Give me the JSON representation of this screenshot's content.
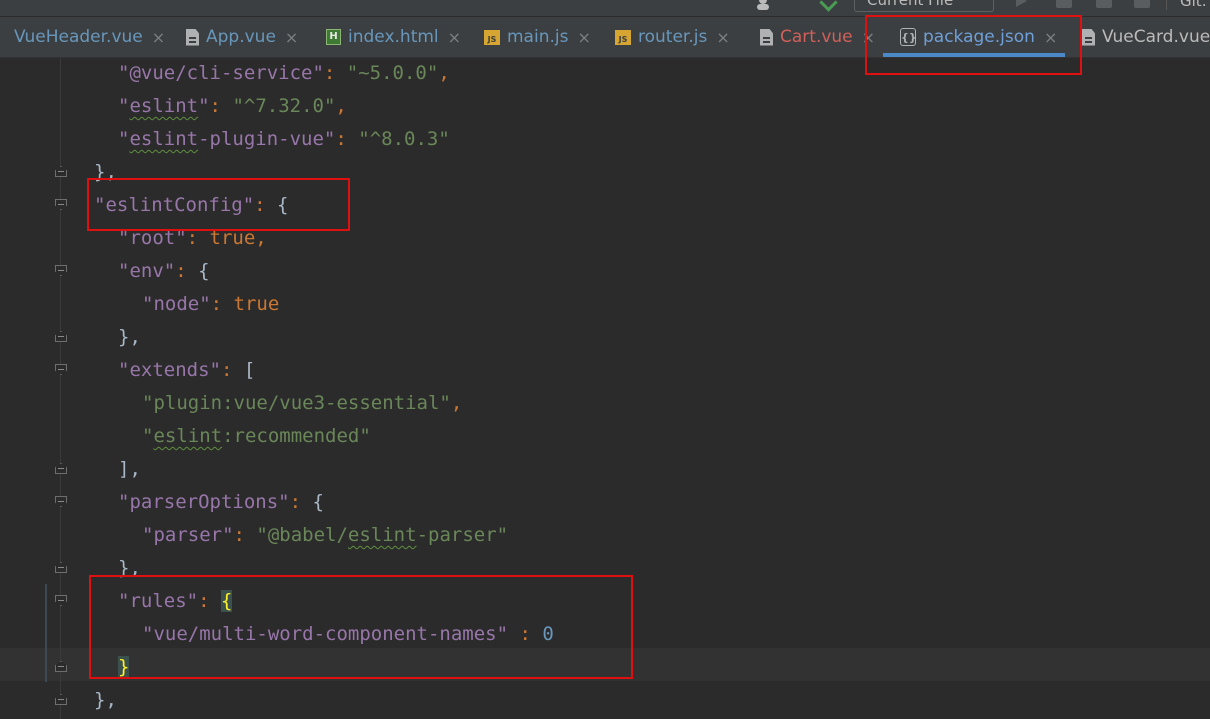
{
  "toolbar": {
    "run_config": "Current File",
    "git_label": "Git:"
  },
  "tabs": [
    {
      "label": "VueHeader.vue",
      "icon": "vue-file-icon",
      "color": "blue",
      "close": "×"
    },
    {
      "label": "App.vue",
      "icon": "vue-file-icon",
      "color": "blue",
      "close": "×"
    },
    {
      "label": "index.html",
      "icon": "html-file-icon",
      "color": "blue",
      "close": "×"
    },
    {
      "label": "main.js",
      "icon": "js-file-icon",
      "color": "blue",
      "close": "×"
    },
    {
      "label": "router.js",
      "icon": "js-file-icon",
      "color": "blue",
      "close": "×"
    },
    {
      "label": "Cart.vue",
      "icon": "vue-file-icon",
      "color": "red",
      "close": "×"
    },
    {
      "label": "package.json",
      "icon": "json-file-icon",
      "color": "active",
      "close": "×"
    },
    {
      "label": "VueCard.vue",
      "icon": "vue-file-icon",
      "color": "white",
      "close": ""
    }
  ],
  "code": {
    "l1": {
      "key": "\"@vue/cli-service\"",
      "value": "\"~5.0.0\""
    },
    "l2": {
      "key_open": "\"",
      "key_sq": "eslint",
      "key_close": "\"",
      "value": "\"^7.32.0\""
    },
    "l3": {
      "key_open": "\"",
      "key_sq": "eslint",
      "key_rest": "-plugin-vue\"",
      "value": "\"^8.0.3\""
    },
    "l4": {
      "text": "},"
    },
    "l5": {
      "key": "\"eslintConfig\"",
      "brace": "{"
    },
    "l6": {
      "key": "\"root\"",
      "value": "true"
    },
    "l7": {
      "key": "\"env\"",
      "brace": "{"
    },
    "l8": {
      "key": "\"node\"",
      "value": "true"
    },
    "l9": {
      "text": "},"
    },
    "l10": {
      "key": "\"extends\"",
      "bracket": "["
    },
    "l11": {
      "value": "\"plugin:vue/vue3-essential\""
    },
    "l12": {
      "open": "\"",
      "sq": "eslint",
      "rest": ":recommended\""
    },
    "l13": {
      "text": "],"
    },
    "l14": {
      "key": "\"parserOptions\"",
      "brace": "{"
    },
    "l15": {
      "key": "\"parser\"",
      "v_open": "\"@babel/",
      "v_sq": "eslint",
      "v_rest": "-parser\""
    },
    "l16": {
      "text": "},"
    },
    "l17": {
      "key": "\"rules\"",
      "brace": "{"
    },
    "l18": {
      "key": "\"vue/multi-word-component-names\"",
      "value": "0"
    },
    "l19": {
      "brace": "}"
    },
    "l20": {
      "text": "},"
    }
  },
  "colors": {
    "highlight_box": "#e01010",
    "json_key": "#9876aa",
    "json_string": "#6a8759",
    "json_keyword": "#cc7832",
    "json_number": "#6897bb"
  }
}
